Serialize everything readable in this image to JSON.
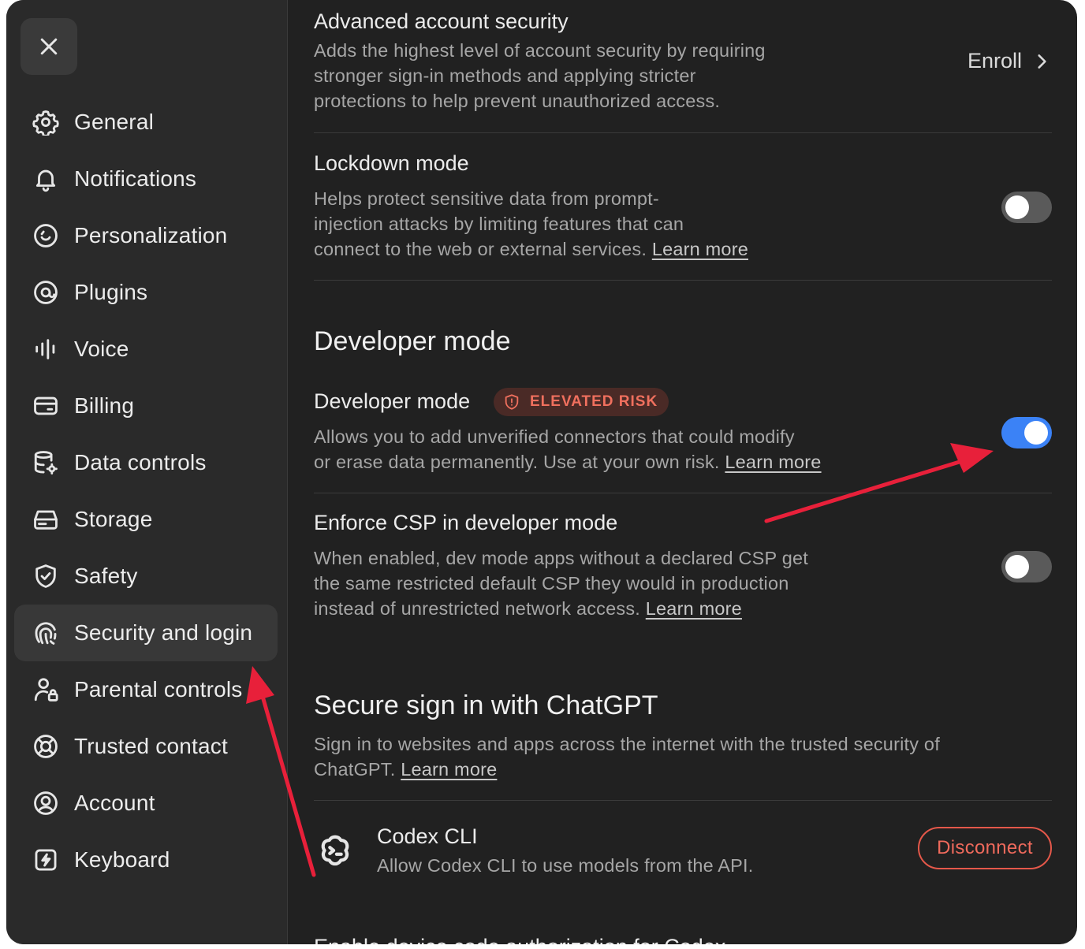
{
  "sidebar": {
    "close_icon": "close-icon",
    "items": [
      {
        "label": "General",
        "icon": "gear-icon"
      },
      {
        "label": "Notifications",
        "icon": "bell-icon"
      },
      {
        "label": "Personalization",
        "icon": "personalization-icon"
      },
      {
        "label": "Plugins",
        "icon": "plugins-icon"
      },
      {
        "label": "Voice",
        "icon": "waveform-icon"
      },
      {
        "label": "Billing",
        "icon": "card-icon"
      },
      {
        "label": "Data controls",
        "icon": "database-gear-icon"
      },
      {
        "label": "Storage",
        "icon": "storage-icon"
      },
      {
        "label": "Safety",
        "icon": "shield-check-icon"
      },
      {
        "label": "Security and login",
        "icon": "security-login-icon",
        "active": true
      },
      {
        "label": "Parental controls",
        "icon": "person-lock-icon"
      },
      {
        "label": "Trusted contact",
        "icon": "lifebuoy-icon"
      },
      {
        "label": "Account",
        "icon": "user-circle-icon"
      },
      {
        "label": "Keyboard",
        "icon": "bolt-key-icon"
      }
    ]
  },
  "advanced_security": {
    "title": "Advanced account security",
    "desc_lines": [
      "Adds the highest level of account security by requiring",
      "stronger sign-in methods and applying stricter",
      "protections to help prevent unauthorized access."
    ],
    "action": "Enroll"
  },
  "lockdown": {
    "title": "Lockdown mode",
    "desc_lines": [
      "Helps protect sensitive data from prompt-",
      "injection attacks by limiting features that can",
      "connect to the web or external services."
    ],
    "link": "Learn more",
    "enabled": false
  },
  "developer_section": {
    "heading": "Developer mode",
    "dev_mode": {
      "title": "Developer mode",
      "badge": "ELEVATED RISK",
      "desc_lines": [
        "Allows you to add unverified connectors that could modify",
        "or erase data permanently. Use at your own risk."
      ],
      "link": "Learn more",
      "enabled": true
    },
    "enforce_csp": {
      "title": "Enforce CSP in developer mode",
      "desc_lines": [
        "When enabled, dev mode apps without a declared CSP get",
        "the same restricted default CSP they would in production",
        "instead of unrestricted network access."
      ],
      "link": "Learn more",
      "enabled": false
    }
  },
  "secure_signin": {
    "heading": "Secure sign in with ChatGPT",
    "desc_lines": [
      "Sign in to websites and apps across the internet with the trusted security of",
      "ChatGPT."
    ],
    "link": "Learn more",
    "app": {
      "name": "Codex CLI",
      "desc": "Allow Codex CLI to use models from the API.",
      "action": "Disconnect"
    }
  },
  "cutoff_text": "Enable device code authorization for Codex",
  "colors": {
    "background": "#212121",
    "sidebar": "#2a2a2a",
    "toggle_on": "#3b82f6",
    "danger": "#e5584a",
    "annotation_arrow": "#e8203a"
  }
}
